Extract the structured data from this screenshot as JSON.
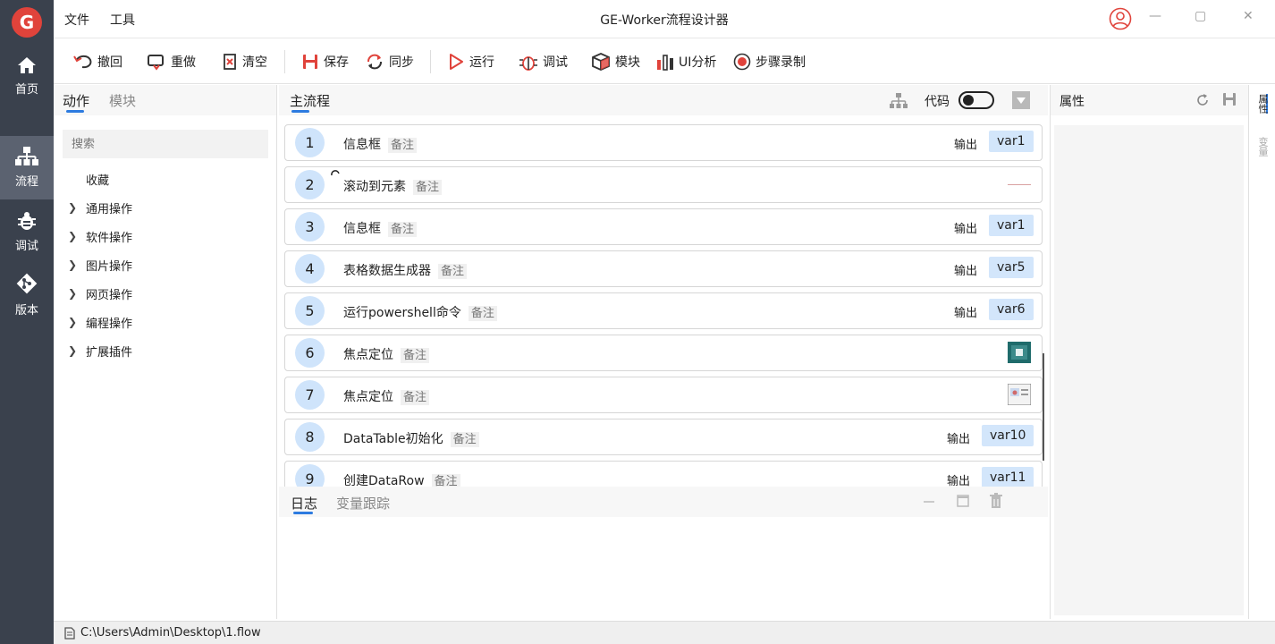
{
  "app": {
    "title": "GE-Worker流程设计器",
    "logo_text": "G",
    "menus": [
      "文件",
      "工具"
    ],
    "window_controls": [
      "—",
      "▢",
      "✕"
    ],
    "brand_color": "#e0433b",
    "accent_color": "#2d7be0"
  },
  "nav": {
    "items": [
      {
        "label": "首页",
        "icon": "home-icon"
      },
      {
        "label": "流程",
        "icon": "flow-icon",
        "active": true
      },
      {
        "label": "调试",
        "icon": "bug-icon"
      },
      {
        "label": "版本",
        "icon": "git-icon"
      }
    ]
  },
  "toolbar": {
    "undo": "撤回",
    "redo": "重做",
    "clear": "清空",
    "save": "保存",
    "sync": "同步",
    "run": "运行",
    "debug": "调试",
    "module": "模块",
    "ui_analysis": "UI分析",
    "record": "步骤录制"
  },
  "left": {
    "tabs": [
      "动作",
      "模块"
    ],
    "search_placeholder": "搜索",
    "favorites": "收藏",
    "categories": [
      "通用操作",
      "软件操作",
      "图片操作",
      "网页操作",
      "编程操作",
      "扩展插件"
    ]
  },
  "flow": {
    "title": "主流程",
    "code_label": "代码",
    "steps": [
      {
        "num": "1",
        "name": "信息框",
        "note": "备注",
        "out": "输出",
        "var": "var1"
      },
      {
        "num": "2",
        "name": "滚动到元素",
        "note": "备注",
        "out": "",
        "var": ""
      },
      {
        "num": "3",
        "name": "信息框",
        "note": "备注",
        "out": "输出",
        "var": "var1"
      },
      {
        "num": "4",
        "name": "表格数据生成器",
        "note": "备注",
        "out": "输出",
        "var": "var5"
      },
      {
        "num": "5",
        "name": "运行powershell命令",
        "note": "备注",
        "out": "输出",
        "var": "var6"
      },
      {
        "num": "6",
        "name": "焦点定位",
        "note": "备注",
        "out": "",
        "var": ""
      },
      {
        "num": "7",
        "name": "焦点定位",
        "note": "备注",
        "out": "",
        "var": ""
      },
      {
        "num": "8",
        "name": "DataTable初始化",
        "note": "备注",
        "out": "输出",
        "var": "var10"
      },
      {
        "num": "9",
        "name": "创建DataRow",
        "note": "备注",
        "out": "输出",
        "var": "var11"
      }
    ]
  },
  "log": {
    "tabs": [
      "日志",
      "变量跟踪"
    ]
  },
  "props": {
    "title": "属性",
    "side_tabs": [
      "属性",
      "变量"
    ]
  },
  "status": {
    "path": "C:\\Users\\Admin\\Desktop\\1.flow"
  }
}
